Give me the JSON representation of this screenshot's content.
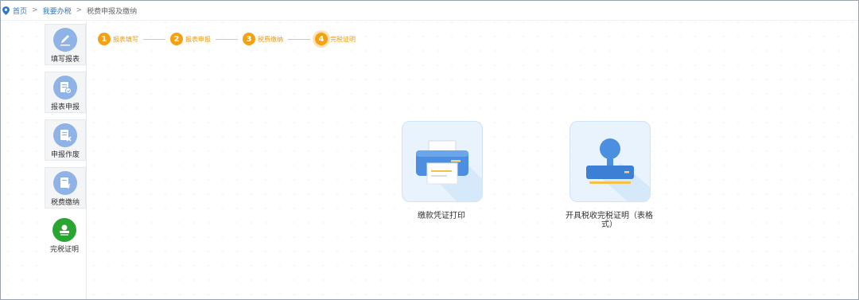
{
  "breadcrumb": {
    "home": "首页",
    "tax": "我要办税",
    "current": "税费申报及缴纳",
    "separator": ">"
  },
  "sidebar": {
    "items": [
      {
        "label": "填写报表",
        "icon": "pencil-icon"
      },
      {
        "label": "报表申报",
        "icon": "report-submit-icon"
      },
      {
        "label": "申报作废",
        "icon": "report-void-icon"
      },
      {
        "label": "税费缴纳",
        "icon": "tax-pay-icon"
      },
      {
        "label": "完税证明",
        "icon": "stamp-icon",
        "active": true
      }
    ]
  },
  "steps": [
    {
      "num": "1",
      "label": "报表填写"
    },
    {
      "num": "2",
      "label": "报表申报"
    },
    {
      "num": "3",
      "label": "税费缴纳"
    },
    {
      "num": "4",
      "label": "完税证明",
      "current": true
    }
  ],
  "cards": [
    {
      "label": "缴款凭证打印",
      "icon": "printer-icon"
    },
    {
      "label": "开具税收完税证明（表格式）",
      "icon": "stamp-icon"
    }
  ],
  "colors": {
    "accent_orange": "#f5a012",
    "link_blue": "#2f78c4",
    "icon_blue": "#8fb3e6",
    "active_green": "#2aa534"
  }
}
